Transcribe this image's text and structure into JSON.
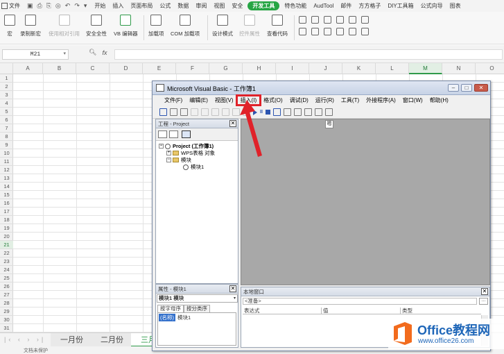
{
  "topbar": {
    "file_label": "文件",
    "tabs": [
      "开始",
      "插入",
      "页面布局",
      "公式",
      "数据",
      "审阅",
      "视图",
      "安全",
      "开发工具",
      "特色功能",
      "AudTool",
      "邮件",
      "方方格子",
      "DIY工具箱",
      "公式向导",
      "图表"
    ],
    "active_tab": "开发工具",
    "active_color": "#26a544"
  },
  "ribbon": {
    "macro": "宏",
    "record": "录制新宏",
    "relative": "使用相对引用",
    "security": "安全全性",
    "vb_editor": "VB 编辑器",
    "addins": "加载项",
    "com_addins": "COM 加载项",
    "design": "设计模式",
    "control_props": "控件属性",
    "view_code": "查看代码"
  },
  "formula_bar": {
    "name_box": "M21",
    "fx": "fx"
  },
  "grid": {
    "columns": [
      "A",
      "B",
      "C",
      "D",
      "E",
      "F",
      "G",
      "H",
      "I",
      "J",
      "K",
      "L",
      "M",
      "N",
      "O"
    ],
    "selected_column": "M",
    "rows": [
      "1",
      "2",
      "3",
      "4",
      "5",
      "6",
      "7",
      "8",
      "9",
      "10",
      "11",
      "12",
      "13",
      "14",
      "15",
      "16",
      "17",
      "18",
      "19",
      "20",
      "21",
      "22",
      "23",
      "24",
      "25",
      "26",
      "27",
      "28",
      "29",
      "30",
      "31"
    ],
    "selected_row": "21"
  },
  "sheets": {
    "tabs": [
      "一月份",
      "二月份",
      "三月份"
    ],
    "active": "三月份",
    "status": "文档未保护"
  },
  "vba": {
    "title": "Microsoft Visual Basic - 工作簿1",
    "menu": [
      "文件(F)",
      "编辑(E)",
      "视图(V)",
      "插入(I)",
      "格式(O)",
      "调试(D)",
      "运行(R)",
      "工具(T)",
      "外接程序(A)",
      "窗口(W)",
      "帮助(H)"
    ],
    "highlighted_menu": "插入(I)",
    "highlight_color": "#e0222a",
    "project_pane": {
      "title": "工程 - Project",
      "tree": {
        "root": "Project (工作簿1)",
        "objects_folder": "WPS表格 对象",
        "modules_folder": "模块",
        "module": "模块1"
      }
    },
    "properties_pane": {
      "title": "属性 - 模块1",
      "object": "模块1 模块",
      "tabs": [
        "按字母序",
        "按分类序"
      ],
      "row_key": "(名称)",
      "row_value": "模块1"
    },
    "code_tip": "嗯",
    "locals": {
      "title": "本地窗口",
      "status": "<准备>",
      "columns": [
        "表达式",
        "值",
        "类型"
      ]
    }
  },
  "watermark": {
    "title": "Office教程网",
    "url": "www.office26.com",
    "colors": {
      "orange": "#f26b1d",
      "blue": "#1e66b8"
    }
  }
}
